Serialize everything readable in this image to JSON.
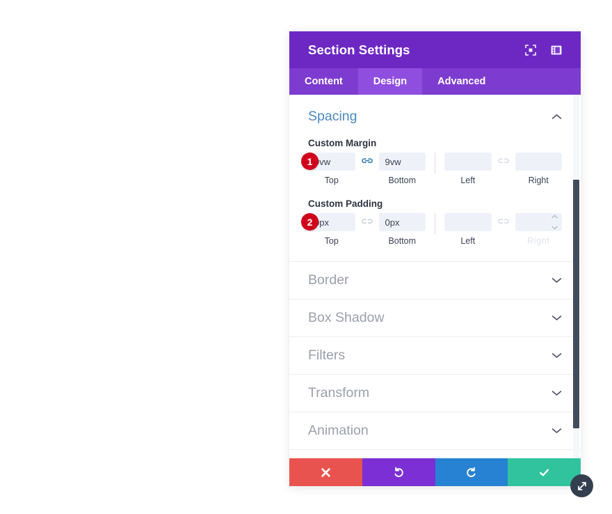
{
  "panel": {
    "title": "Section Settings",
    "header_icons": [
      {
        "name": "fullscreen-expand-icon"
      },
      {
        "name": "panel-layout-icon"
      }
    ],
    "tabs": [
      {
        "label": "Content",
        "active": false
      },
      {
        "label": "Design",
        "active": true
      },
      {
        "label": "Advanced",
        "active": false
      }
    ]
  },
  "spacing": {
    "title": "Spacing",
    "expanded": true,
    "groups": [
      {
        "label": "Custom Margin",
        "badge": "1",
        "link_left_pair": {
          "icon": "link-connected-icon",
          "state": "linked",
          "color": "#2a7ab0"
        },
        "link_right_pair": {
          "icon": "link-broken-icon",
          "state": "unlinked",
          "color": "#d7dce4"
        },
        "fields": [
          {
            "caption": "Top",
            "value": "9vw",
            "placeholder": "",
            "spinner": false,
            "ghost_caption": false
          },
          {
            "caption": "Bottom",
            "value": "9vw",
            "placeholder": "",
            "spinner": false,
            "ghost_caption": false
          },
          {
            "caption": "Left",
            "value": "",
            "placeholder": "",
            "spinner": false,
            "ghost_caption": false
          },
          {
            "caption": "Right",
            "value": "",
            "placeholder": "",
            "spinner": false,
            "ghost_caption": false
          }
        ]
      },
      {
        "label": "Custom Padding",
        "badge": "2",
        "link_left_pair": {
          "icon": "link-broken-icon",
          "state": "unlinked",
          "color": "#c9d0da"
        },
        "link_right_pair": {
          "icon": "link-broken-icon",
          "state": "unlinked",
          "color": "#d7dce4"
        },
        "fields": [
          {
            "caption": "Top",
            "value": "0px",
            "placeholder": "",
            "spinner": false,
            "ghost_caption": false
          },
          {
            "caption": "Bottom",
            "value": "0px",
            "placeholder": "",
            "spinner": false,
            "ghost_caption": false
          },
          {
            "caption": "Left",
            "value": "",
            "placeholder": "",
            "spinner": false,
            "ghost_caption": false
          },
          {
            "caption": "Right",
            "value": "",
            "placeholder": "",
            "spinner": true,
            "ghost_caption": true
          }
        ]
      }
    ]
  },
  "collapsed_sections": [
    {
      "label": "Border"
    },
    {
      "label": "Box Shadow"
    },
    {
      "label": "Filters"
    },
    {
      "label": "Transform"
    },
    {
      "label": "Animation"
    }
  ],
  "actions": [
    {
      "name": "cancel",
      "icon": "close-x-icon",
      "color": "#e8534f"
    },
    {
      "name": "undo",
      "icon": "undo-icon",
      "color": "#7b2fd4"
    },
    {
      "name": "redo",
      "icon": "redo-icon",
      "color": "#2782d3"
    },
    {
      "name": "save",
      "icon": "checkmark-icon",
      "color": "#30c39e"
    }
  ],
  "resize_handle": {
    "icon": "resize-diagonal-icon"
  },
  "colors": {
    "header_purple": "#6d28c4",
    "tabbar_purple": "#7e3bd0",
    "tab_active_purple": "#8f4ee0",
    "section_title_blue": "#4b89bf",
    "badge_red": "#d0021b",
    "input_bg": "#eef2f8",
    "scrollbar_thumb": "#434c5e"
  }
}
